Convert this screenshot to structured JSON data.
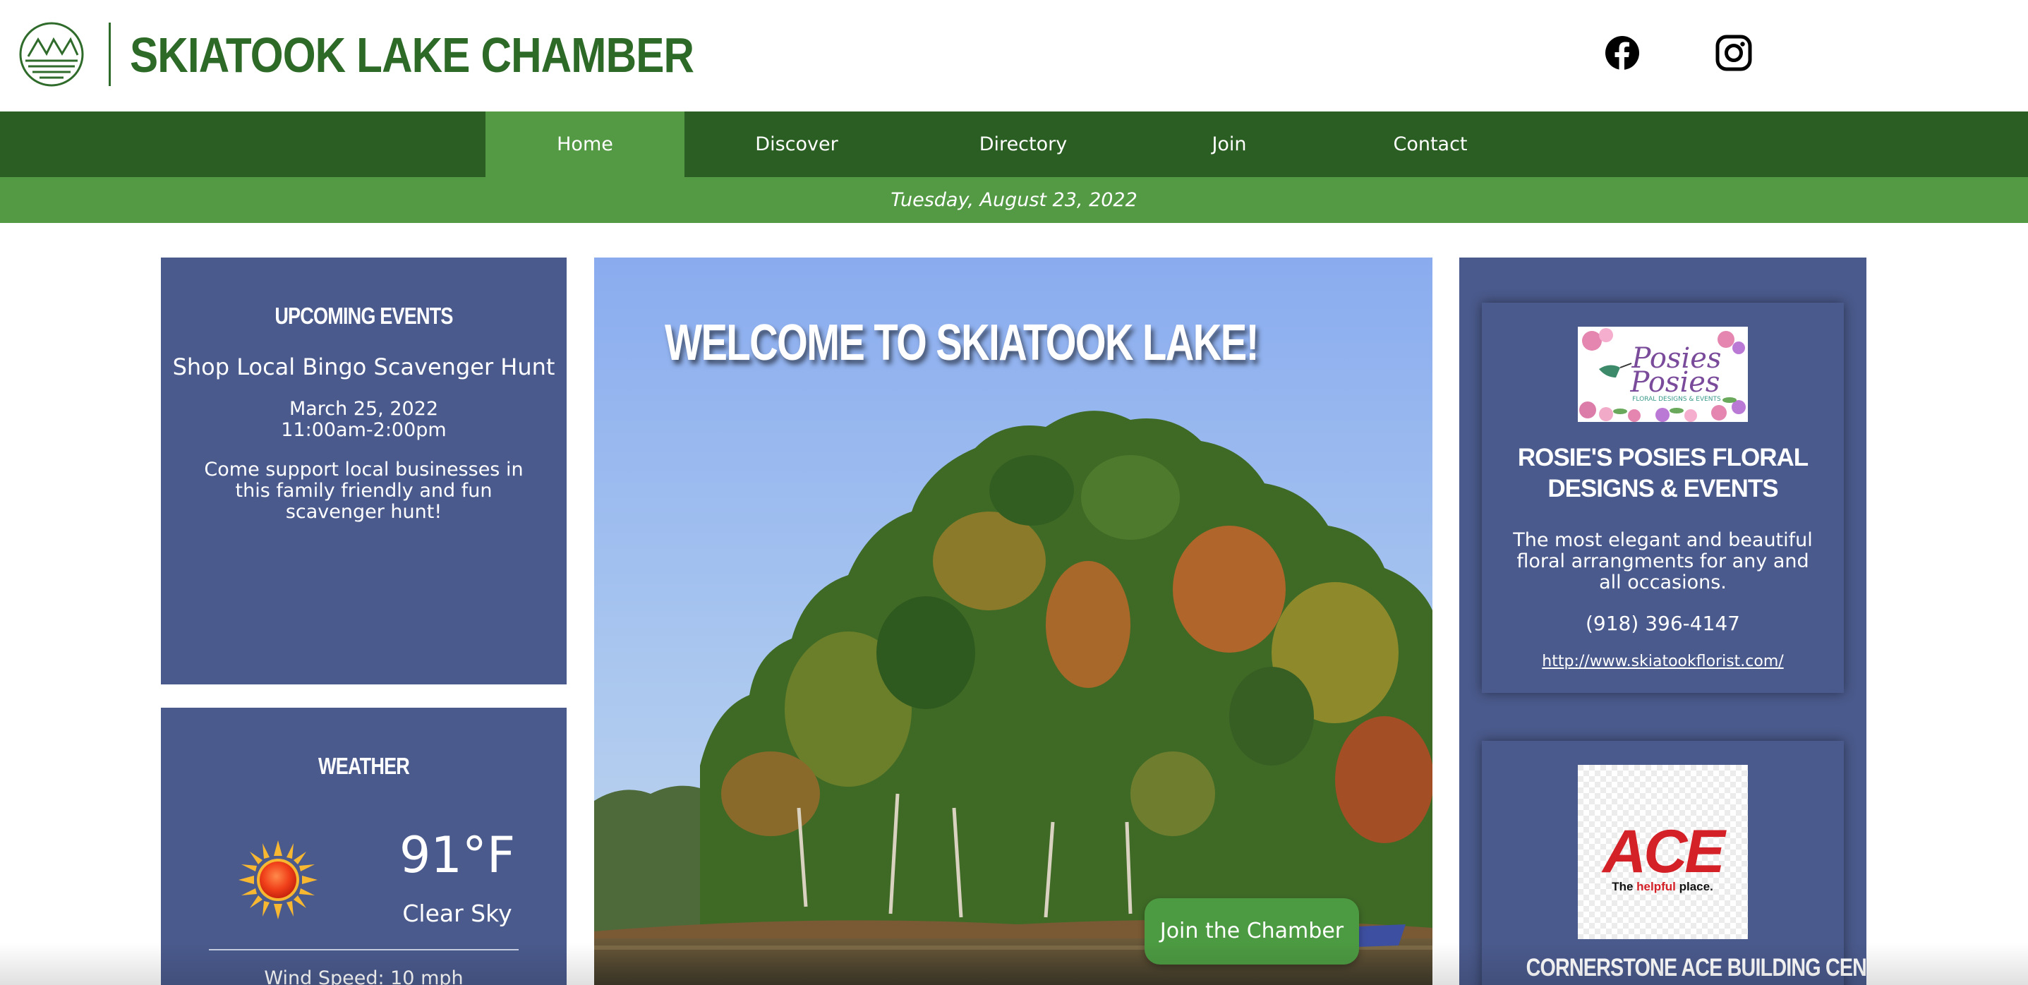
{
  "header": {
    "site_title": "SKIATOOK LAKE CHAMBER",
    "social": [
      "facebook-icon",
      "instagram-icon"
    ]
  },
  "nav": {
    "items": [
      {
        "label": "Home",
        "active": true
      },
      {
        "label": "Discover"
      },
      {
        "label": "Directory"
      },
      {
        "label": "Join"
      },
      {
        "label": "Contact"
      }
    ]
  },
  "date_bar": "Tuesday, August 23, 2022",
  "events": {
    "heading": "UPCOMING EVENTS",
    "title": "Shop Local Bingo Scavenger Hunt",
    "date": "March 25, 2022",
    "time": "11:00am-2:00pm",
    "description": "Come support local businesses in this family friendly and fun scavenger hunt!"
  },
  "weather": {
    "heading": "WEATHER",
    "icon": "sun-icon",
    "temperature": "91°F",
    "condition": "Clear Sky",
    "wind": "Wind Speed: 10 mph"
  },
  "hero": {
    "title": "WELCOME TO SKIATOOK LAKE!",
    "cta": "Join the Chamber"
  },
  "businesses": [
    {
      "name": "ROSIE'S POSIES FLORAL DESIGNS & EVENTS",
      "logo_text": "Posies",
      "logo_subtext": "FLORAL DESIGNS & EVENTS",
      "description": "The most elegant and beautiful floral arrangments for any and all occasions.",
      "phone": "(918) 396-4147",
      "url": "http://www.skiatookflorist.com/"
    },
    {
      "name": "CORNERSTONE ACE BUILDING CENTER",
      "logo_text": "ACE",
      "logo_tagline_a": "The ",
      "logo_tagline_b": "helpful",
      "logo_tagline_c": " place."
    }
  ],
  "colors": {
    "dark_green": "#2a5e22",
    "light_green": "#549a45",
    "card_blue": "#4a5a8c",
    "title_green": "#2d6a28"
  }
}
